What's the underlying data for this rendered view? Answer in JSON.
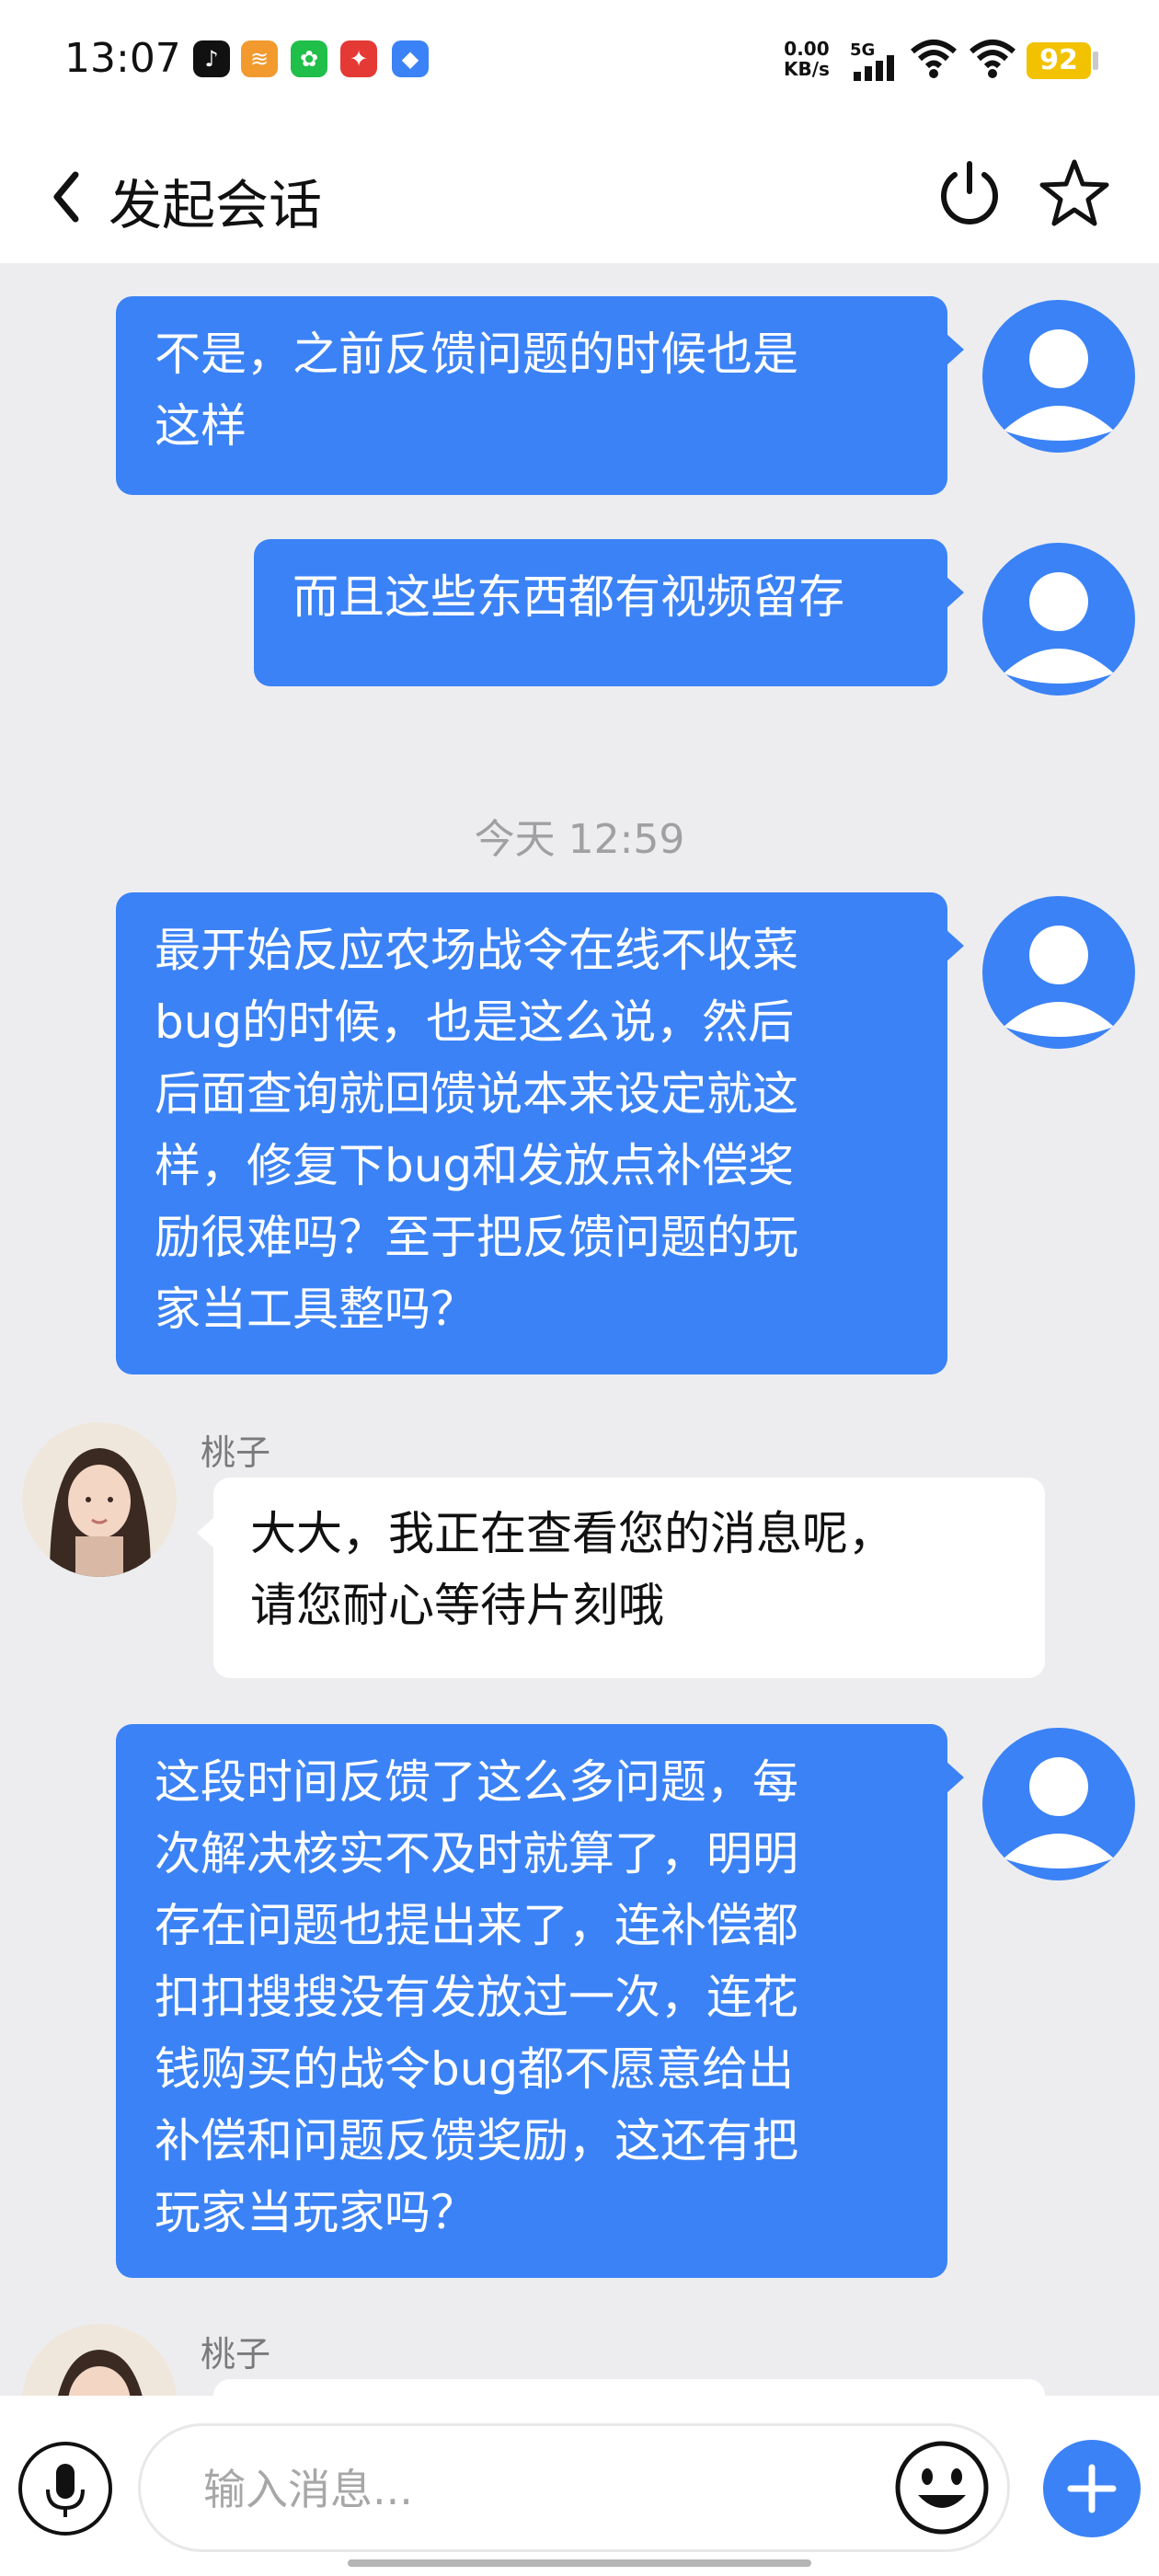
{
  "status_bar": {
    "time": "13:07",
    "apps": [
      {
        "name": "tiktok-icon",
        "color": "#111111",
        "glyph": "♪"
      },
      {
        "name": "orange-app-icon",
        "color": "#f29a2e",
        "glyph": "≋"
      },
      {
        "name": "wechat-icon",
        "color": "#1fbf4a",
        "glyph": "✿"
      },
      {
        "name": "red-app-icon",
        "color": "#e53935",
        "glyph": "✦"
      },
      {
        "name": "blue-app-icon",
        "color": "#3b82f6",
        "glyph": "◆"
      }
    ],
    "net_speed_value": "0.00",
    "net_speed_unit": "KB/s",
    "signal_label": "5G",
    "battery": "92"
  },
  "nav": {
    "title": "发起会话"
  },
  "messages": [
    {
      "type": "out",
      "lines": [
        "不是，之前反馈问题的时候也是",
        "这样"
      ]
    },
    {
      "type": "out",
      "lines": [
        "而且这些东西都有视频留存"
      ]
    },
    {
      "type": "timestamp",
      "text": "今天 12:59"
    },
    {
      "type": "out",
      "lines": [
        "最开始反应农场战令在线不收菜",
        "bug的时候，也是这么说，然后",
        "后面查询就回馈说本来设定就这",
        "样，修复下bug和发放点补偿奖",
        "励很难吗？至于把反馈问题的玩",
        "家当工具整吗？"
      ]
    },
    {
      "type": "in",
      "sender": "桃子",
      "lines": [
        "大大，我正在查看您的消息呢，",
        "请您耐心等待片刻哦"
      ]
    },
    {
      "type": "out",
      "lines": [
        "这段时间反馈了这么多问题，每",
        "次解决核实不及时就算了，明明",
        "存在问题也提出来了，连补偿都",
        "扣扣搜搜没有发放过一次，连花",
        "钱购买的战令bug都不愿意给出",
        "补偿和问题反馈奖励，这还有把",
        "玩家当玩家吗？"
      ]
    },
    {
      "type": "in",
      "sender": "桃子",
      "lines": []
    }
  ],
  "input": {
    "placeholder": "输入消息..."
  },
  "colors": {
    "accent": "#3b82f6",
    "bubble_in": "#ffffff",
    "background": "#ededf0"
  }
}
